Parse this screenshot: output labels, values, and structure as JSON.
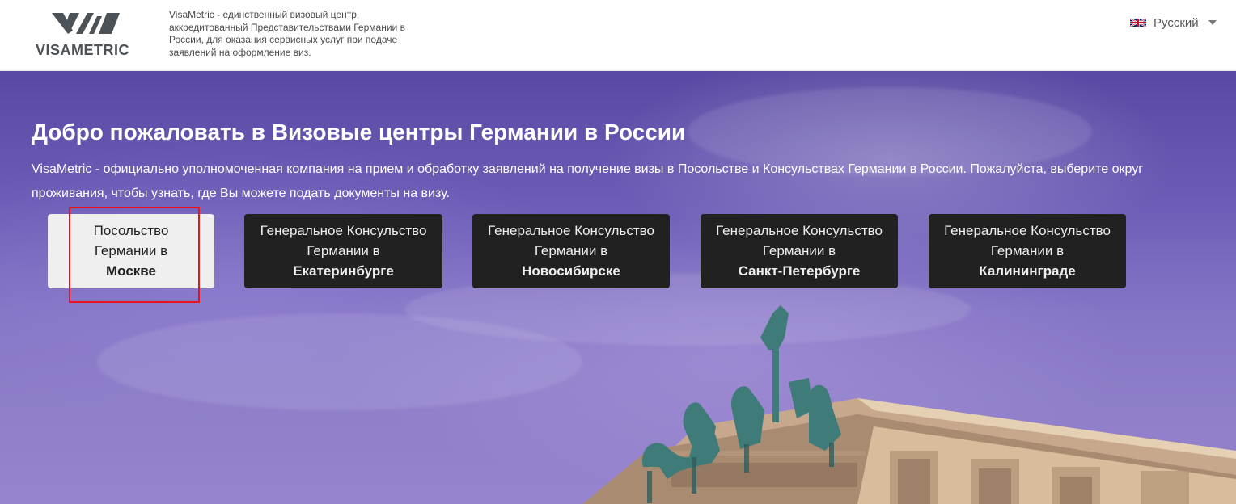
{
  "header": {
    "logo_text": "VISAMETRIC",
    "tagline": "VisaMetric - единственный визовый центр, аккредитованный Представительствами Германии в России, для оказания сервисных услуг при подаче заявлений на оформление виз.",
    "language": {
      "label": "Русский",
      "flag_icon": "uk-flag-icon"
    }
  },
  "hero": {
    "title": "Добро пожаловать в Визовые центры Германии в России",
    "description": "VisaMetric - официально уполномоченная компания на прием и обработку заявлений на получение визы в Посольстве и Консульствах Германии в России. Пожалуйста, выберите округ проживания, чтобы узнать, где Вы можете подать документы на визу.",
    "locations": [
      {
        "line1": "Посольство",
        "line2": "Германии в",
        "city": "Москве",
        "active": true
      },
      {
        "line1": "Генеральное Консульство",
        "line2": "Германии в",
        "city": "Екатеринбурге",
        "active": false
      },
      {
        "line1": "Генеральное Консульство",
        "line2": "Германии в",
        "city": "Новосибирске",
        "active": false
      },
      {
        "line1": "Генеральное Консульство",
        "line2": "Германии в",
        "city": "Санкт-Петербурге",
        "active": false
      },
      {
        "line1": "Генеральное Консульство",
        "line2": "Германии в",
        "city": "Калининграде",
        "active": false
      }
    ]
  },
  "colors": {
    "highlight": "#e8131b",
    "button_dark": "#212121",
    "button_active": "#efefef",
    "logo": "#4d5257"
  }
}
